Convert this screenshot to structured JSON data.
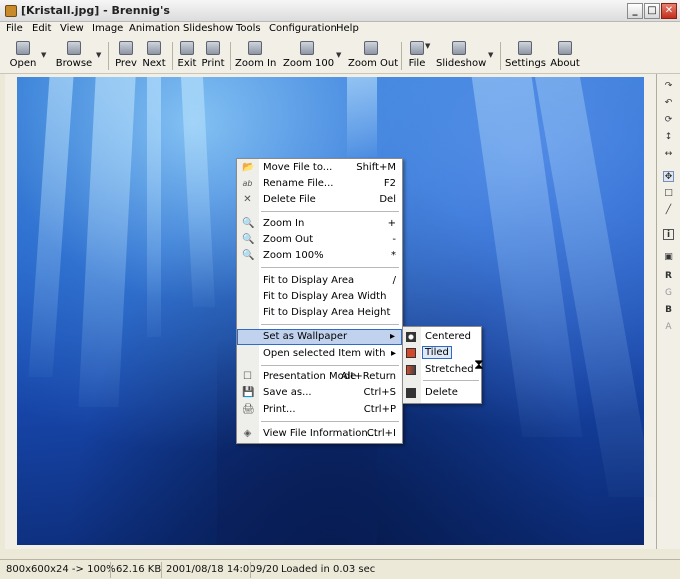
{
  "window": {
    "title": "[Kristall.jpg] - Brennig's",
    "controls": [
      "_",
      "□",
      "✕"
    ]
  },
  "menubar": [
    "File",
    "Edit",
    "View",
    "Image",
    "Animation",
    "Slideshow",
    "Tools",
    "Configuration",
    "Help"
  ],
  "toolbar": {
    "open": "Open",
    "browse": "Browse",
    "prev": "Prev",
    "next": "Next",
    "exit": "Exit",
    "print": "Print",
    "zoom_in": "Zoom In",
    "zoom_100": "Zoom 100",
    "zoom_out": "Zoom Out",
    "file": "File",
    "slideshow": "Slideshow",
    "settings": "Settings",
    "about": "About"
  },
  "right_tools": {
    "rotate_cw_icon": "↷",
    "rotate_ccw_icon": "↶",
    "rotate_free_icon": "⟳",
    "flip_v_icon": "↕",
    "flip_h_icon": "↔",
    "move_icon": "✥",
    "select_icon": "□",
    "line_icon": "╱",
    "info_icon": "i",
    "image_icon": "▣",
    "channel_r": "R",
    "channel_g": "G",
    "channel_b": "B",
    "channel_a": "A"
  },
  "context_menu": {
    "items": [
      {
        "label": "Move File to...",
        "shortcut": "Shift+M",
        "icon": "📂"
      },
      {
        "label": "Rename File...",
        "shortcut": "F2",
        "icon": "ab"
      },
      {
        "label": "Delete File",
        "shortcut": "Del",
        "icon": "✕"
      },
      {
        "label": "Zoom In",
        "shortcut": "+",
        "icon": "🔍"
      },
      {
        "label": "Zoom Out",
        "shortcut": "-",
        "icon": "🔍"
      },
      {
        "label": "Zoom 100%",
        "shortcut": "*",
        "icon": "🔍"
      },
      {
        "label": "Fit to Display Area",
        "shortcut": "/"
      },
      {
        "label": "Fit to Display Area Width",
        "shortcut": ""
      },
      {
        "label": "Fit to Display Area Height",
        "shortcut": ""
      },
      {
        "label": "Set as Wallpaper",
        "shortcut": "▸"
      },
      {
        "label": "Open selected Item with",
        "shortcut": "▸"
      },
      {
        "label": "Presentation Mode",
        "shortcut": "Alt+Return",
        "icon": "☐"
      },
      {
        "label": "Save as...",
        "shortcut": "Ctrl+S",
        "icon": "💾"
      },
      {
        "label": "Print...",
        "shortcut": "Ctrl+P",
        "icon": "🖨"
      },
      {
        "label": "View File Information...",
        "shortcut": "Ctrl+I",
        "icon": "◈"
      }
    ]
  },
  "submenu": {
    "items": [
      {
        "label": "Centered"
      },
      {
        "label": "Tiled"
      },
      {
        "label": "Stretched"
      },
      {
        "label": "Delete"
      }
    ]
  },
  "statusbar": {
    "dims": "800x600x24 -> 100%",
    "size": "62.16 KB",
    "date": "2001/08/18 14:00",
    "position": "9/20",
    "loaded": "Loaded in 0.03 sec"
  }
}
